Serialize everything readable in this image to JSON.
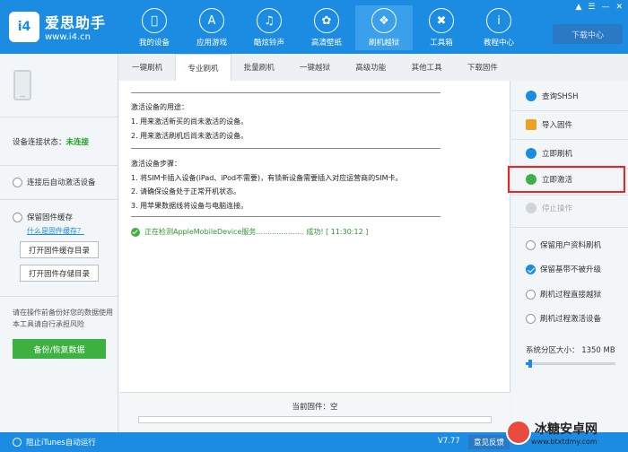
{
  "app": {
    "brand": "爱思助手",
    "url": "www.i4.cn",
    "logo_mark": "i4"
  },
  "nav": [
    {
      "label": "我的设备",
      "icon": "apple-icon"
    },
    {
      "label": "应用游戏",
      "icon": "app-store-icon"
    },
    {
      "label": "酷炫铃声",
      "icon": "bell-icon"
    },
    {
      "label": "高清壁纸",
      "icon": "flower-icon"
    },
    {
      "label": "刷机越狱",
      "icon": "dropbox-icon"
    },
    {
      "label": "工具箱",
      "icon": "tools-icon"
    },
    {
      "label": "教程中心",
      "icon": "info-icon"
    }
  ],
  "download_center": "下载中心",
  "left": {
    "status_label": "设备连接状态：",
    "status_value": "未连接",
    "auto_activate": "连接后自动激活设备",
    "keep_cache": "保留固件缓存",
    "what_is_cache": "什么是固件缓存？",
    "open_cache_dir": "打开固件缓存目录",
    "open_storage_dir": "打开固件存储目录",
    "warning": "请在操作前备份好您的数据使用本工具请自行承担风险",
    "backup_button": "备份/恢复数据"
  },
  "tabs": [
    "一键刷机",
    "专业刷机",
    "批量刷机",
    "一键越狱",
    "高级功能",
    "其他工具",
    "下载固件"
  ],
  "content": {
    "purpose_title": "激活设备的用途：",
    "purpose_1": "1. 用来激活新买的尚未激活的设备。",
    "purpose_2": "2. 用来激活刷机后尚未激活的设备。",
    "steps_title": "激活设备步骤：",
    "step_1": "1. 将SIM卡插入设备(iPad、iPod不需要)，有锁新设备需要插入对应运营商的SIM卡。",
    "step_2": "2. 请确保设备处于正常开机状态。",
    "step_3": "3. 用苹果数据线将设备与电脑连接。",
    "status_line": "正在检测AppleMobileDevice服务..................... 成功! [ 11:30:12 ]",
    "current_firmware": "当前固件：空"
  },
  "right": {
    "query_shsh": "查询SHSH",
    "import_firmware": "导入固件",
    "flash_now": "立即刷机",
    "activate_now": "立即激活",
    "stop": "停止操作",
    "opt_keep_data": "保留用户资料刷机",
    "opt_no_upgrade": "保留基带不被升级",
    "opt_jailbreak": "刷机过程直接越狱",
    "opt_activate": "刷机过程激活设备",
    "sys_partition": "系统分区大小： 1350 MB",
    "slider_value": 0.05
  },
  "footer": {
    "block_itunes": "阻止iTunes自动运行",
    "version": "V7.77",
    "feedback": "意见反馈"
  },
  "watermark": {
    "text": "冰糖安卓网",
    "url": "www.btxtdmy.com"
  },
  "colors": {
    "brand_blue": "#1c8ce3",
    "green": "#3db142",
    "highlight_red": "#e8262a"
  }
}
